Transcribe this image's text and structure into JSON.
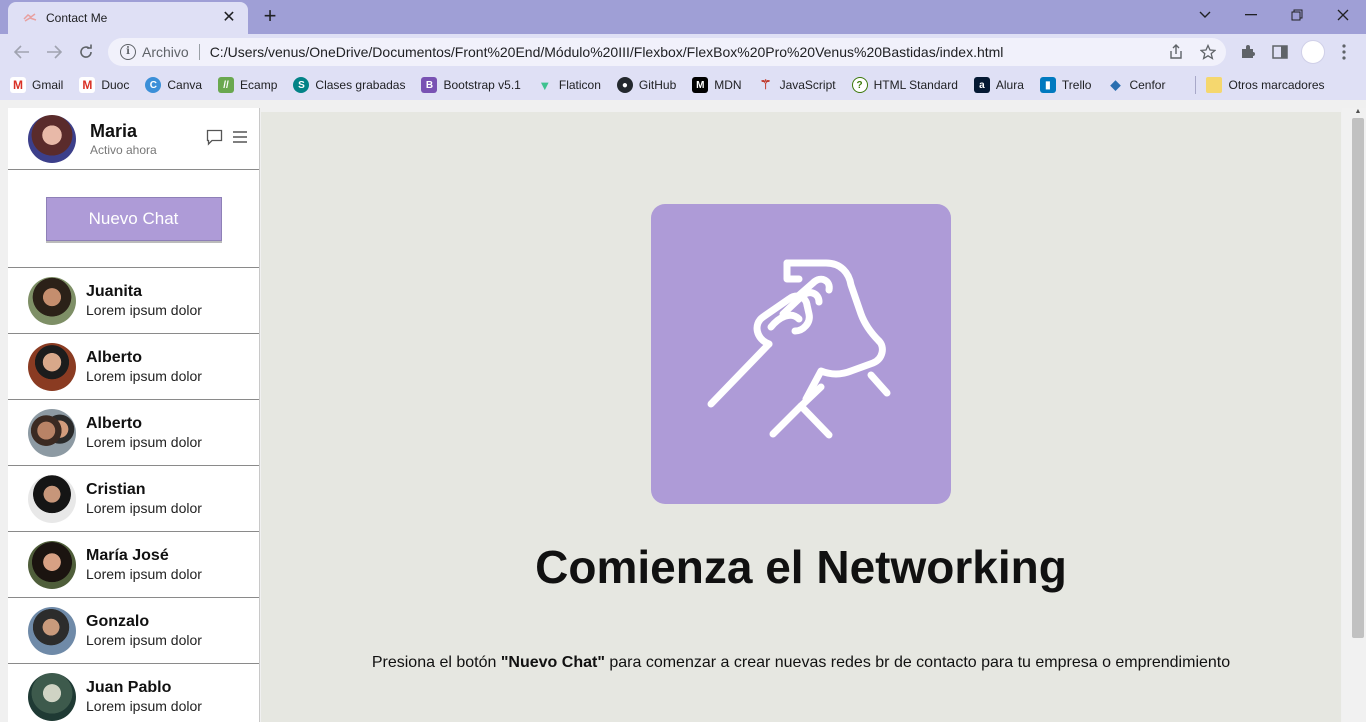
{
  "browser": {
    "tab_title": "Contact Me",
    "address_scheme": "Archivo",
    "address_url": "C:/Users/venus/OneDrive/Documentos/Front%20End/Módulo%20III/Flexbox/FlexBox%20Pro%20Venus%20Bastidas/index.html",
    "bookmarks": [
      "Gmail",
      "Duoc",
      "Canva",
      "Ecamp",
      "Clases grabadas",
      "Bootstrap v5.1",
      "Flaticon",
      "GitHub",
      "MDN",
      "JavaScript",
      "HTML Standard",
      "Alura",
      "Trello",
      "Cenfor"
    ],
    "other_bookmarks": "Otros marcadores"
  },
  "user": {
    "name": "Maria",
    "status": "Activo ahora"
  },
  "sidebar": {
    "new_chat_label": "Nuevo Chat",
    "contacts": [
      {
        "name": "Juanita",
        "message": "Lorem ipsum dolor"
      },
      {
        "name": "Alberto",
        "message": "Lorem ipsum dolor"
      },
      {
        "name": "Alberto",
        "message": "Lorem ipsum dolor"
      },
      {
        "name": "Cristian",
        "message": "Lorem ipsum dolor"
      },
      {
        "name": "María José",
        "message": "Lorem ipsum dolor"
      },
      {
        "name": "Gonzalo",
        "message": "Lorem ipsum dolor"
      },
      {
        "name": "Juan Pablo",
        "message": "Lorem ipsum dolor"
      }
    ]
  },
  "main": {
    "title": "Comienza el Networking",
    "description_before": "Presiona el botón ",
    "description_bold": "\"Nuevo Chat\"",
    "description_after": " para comenzar a crear nuevas redes br de contacto para tu empresa o emprendimiento"
  },
  "colors": {
    "accent": "#ae9bd7",
    "main_bg": "#e6e7e1",
    "chrome_frame": "#9f9fd6",
    "chrome_toolbar": "#dfe0f5"
  }
}
